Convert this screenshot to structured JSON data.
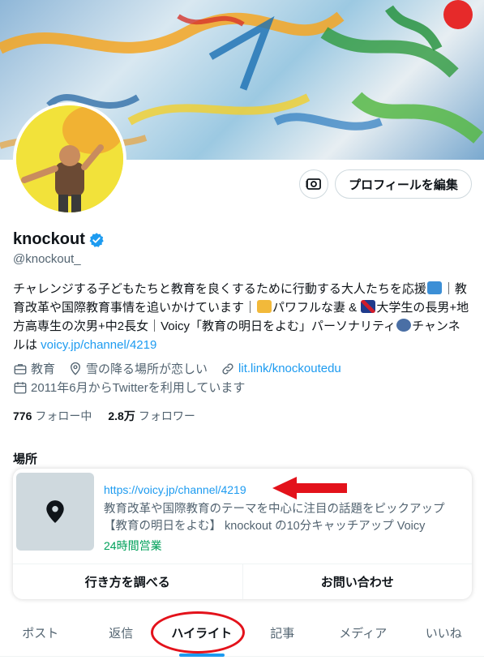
{
  "profile": {
    "name": "knockout",
    "handle": "@knockout_",
    "edit_button": "プロフィールを編集",
    "bio_part1": "チャレンジする子どもたちと教育を良くするために行動する大人たちを応援",
    "bio_part2": "｜教育改革や国際教育事情を追いかけています｜",
    "bio_part3": "パワフルな妻 & ",
    "bio_part4": "大学生の長男+地方高専生の次男+中2長女｜Voicy「教育の明日をよむ」パーソナリティ",
    "bio_part5": "チャンネルは ",
    "bio_link": "voicy.jp/channel/4219",
    "category": "教育",
    "location": "雪の降る場所が恋しい",
    "website": "lit.link/knockoutedu",
    "joined": "2011年6月からTwitterを利用しています",
    "following_count": "776",
    "following_label": "フォロー中",
    "followers_count": "2.8万",
    "followers_label": "フォロワー"
  },
  "place": {
    "title": "場所",
    "url": "https://voicy.jp/channel/4219",
    "description": "教育改革や国際教育のテーマを中心に注目の話題をピックアップ【教育の明日をよむ】 knockout の10分キャッチアップ Voicy",
    "hours": "24時間営業",
    "directions_button": "行き方を調べる",
    "contact_button": "お問い合わせ"
  },
  "tabs": [
    {
      "label": "ポスト"
    },
    {
      "label": "返信"
    },
    {
      "label": "ハイライト"
    },
    {
      "label": "記事"
    },
    {
      "label": "メディア"
    },
    {
      "label": "いいね"
    }
  ],
  "colors": {
    "accent": "#1d9bf0",
    "annotation": "#e3121b",
    "open_status": "#00a05a"
  },
  "icons": [
    "verified-badge-icon",
    "briefcase-icon",
    "location-pin-icon",
    "link-icon",
    "calendar-icon",
    "money-icon",
    "map-pin-icon"
  ]
}
